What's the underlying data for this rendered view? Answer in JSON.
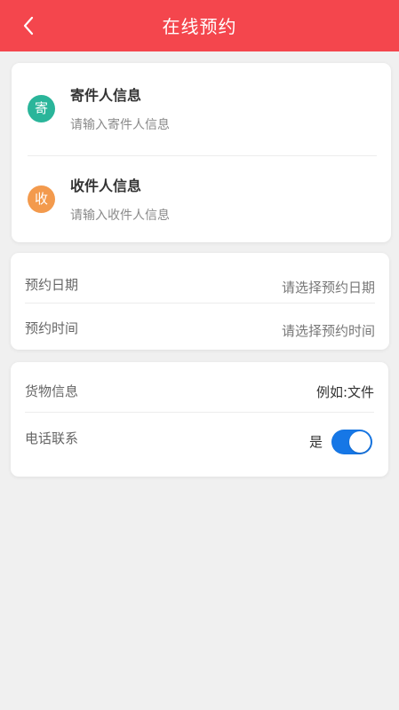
{
  "header": {
    "title": "在线预约",
    "back_icon": "chevron-left-icon"
  },
  "people_card": {
    "sender": {
      "badge_text": "寄",
      "badge_color": "#2ab59a",
      "title": "寄件人信息",
      "hint": "请输入寄件人信息"
    },
    "receiver": {
      "badge_text": "收",
      "badge_color": "#f39a4d",
      "title": "收件人信息",
      "hint": "请输入收件人信息"
    }
  },
  "schedule_card": {
    "date": {
      "label": "预约日期",
      "value": "请选择预约日期"
    },
    "time": {
      "label": "预约时间",
      "value": "请选择预约时间"
    }
  },
  "cargo_card": {
    "cargo": {
      "label": "货物信息",
      "value": "例如:文件"
    },
    "phone_contact": {
      "label": "电话联系",
      "value": "是",
      "enabled": true
    }
  },
  "colors": {
    "header_background": "#f4464d",
    "switch_on": "#1677e6",
    "page_background": "#f0f0f0"
  }
}
